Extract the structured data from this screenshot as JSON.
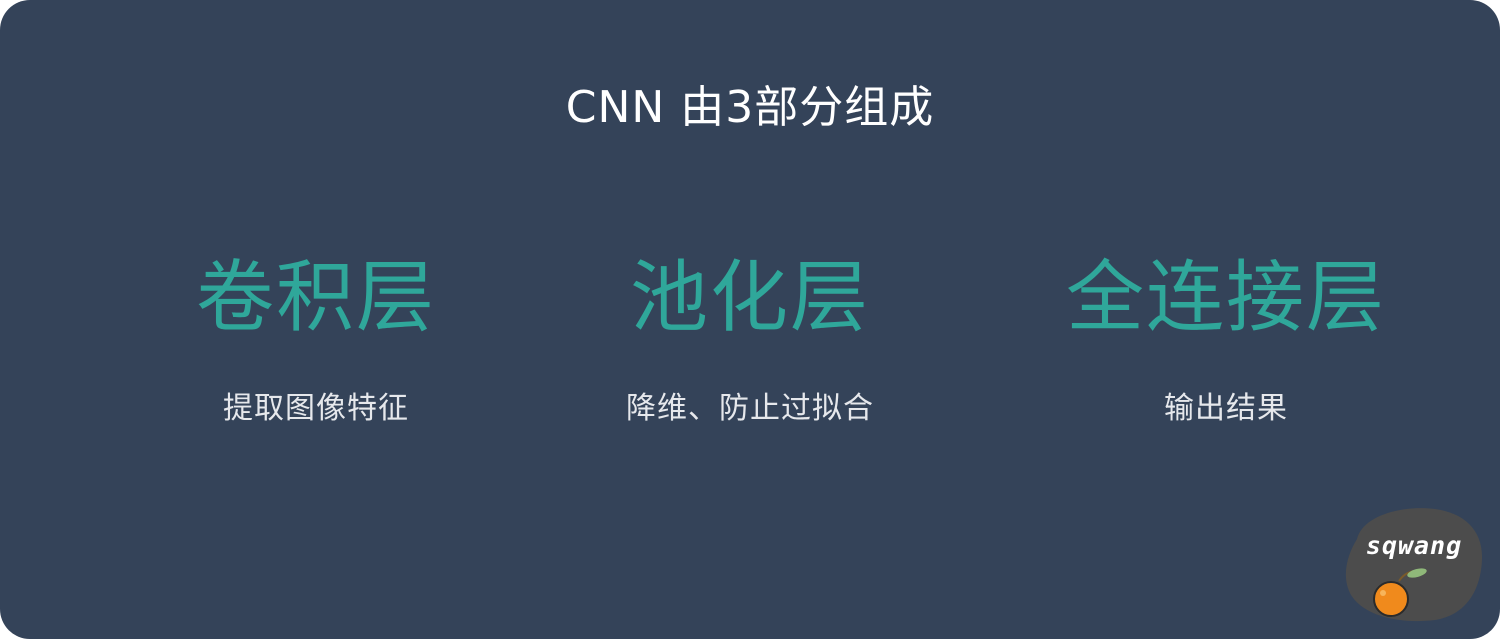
{
  "title": "CNN 由3部分组成",
  "layers": [
    {
      "name": "卷积层",
      "description": "提取图像特征"
    },
    {
      "name": "池化层",
      "description": "降维、防止过拟合"
    },
    {
      "name": "全连接层",
      "description": "输出结果"
    }
  ],
  "logo": {
    "text": "sqwang",
    "icon": "orange-icon"
  },
  "colors": {
    "background": "#344359",
    "accent": "#2fa79a",
    "text": "#ffffff"
  }
}
